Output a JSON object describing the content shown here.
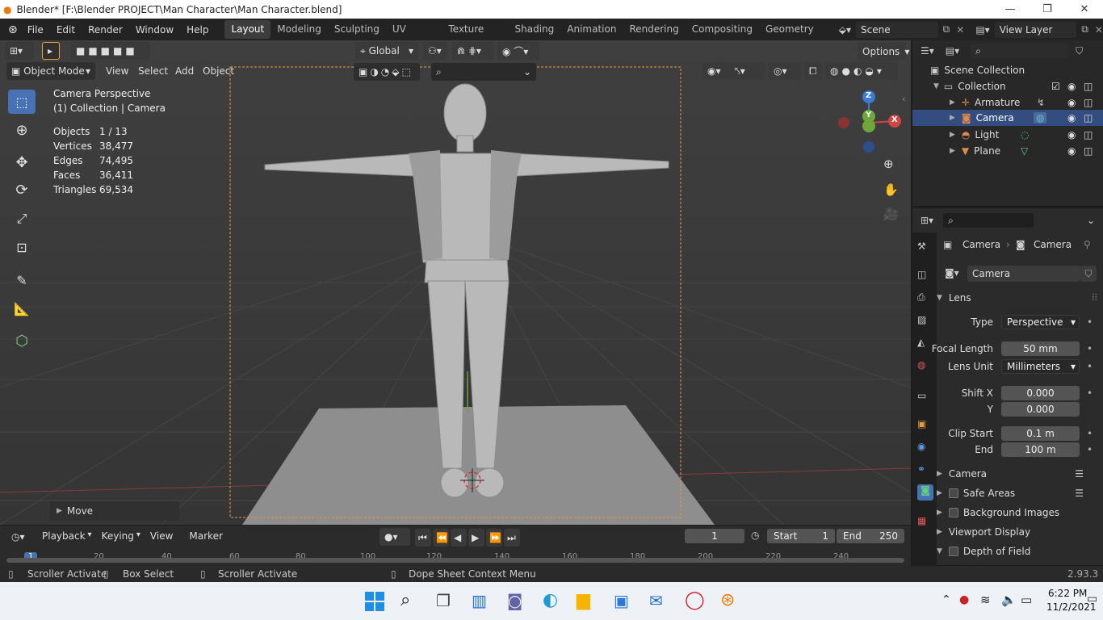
{
  "window": {
    "title": "Blender* [F:\\Blender PROJECT\\Man Character\\Man Character.blend]"
  },
  "menus": [
    "File",
    "Edit",
    "Render",
    "Window",
    "Help"
  ],
  "workspace_tabs": [
    "Layout",
    "Modeling",
    "Sculpting",
    "UV Editing",
    "Texture Paint",
    "Shading",
    "Animation",
    "Rendering",
    "Compositing",
    "Geometry Nod"
  ],
  "active_tab": "Layout",
  "scene_field": "Scene",
  "view_layer_field": "View Layer",
  "viewport": {
    "mode": "Object Mode",
    "menus": [
      "View",
      "Select",
      "Add",
      "Object"
    ],
    "transform_orientation": "Global",
    "options_label": "Options",
    "overlay_title": "Camera Perspective",
    "overlay_subtitle": "(1) Collection | Camera",
    "stats": [
      {
        "label": "Objects",
        "value": "1 / 13"
      },
      {
        "label": "Vertices",
        "value": "38,477"
      },
      {
        "label": "Edges",
        "value": "74,495"
      },
      {
        "label": "Faces",
        "value": "36,411"
      },
      {
        "label": "Triangles",
        "value": "69,534"
      }
    ],
    "last_op": "Move",
    "gizmo": {
      "z": "Z",
      "y": "Y",
      "x": "X"
    }
  },
  "outliner": {
    "root": "Scene Collection",
    "collection": "Collection",
    "items": [
      {
        "name": "Armature",
        "color": "#e0894a"
      },
      {
        "name": "Camera",
        "color": "#e0894a"
      },
      {
        "name": "Light",
        "color": "#e0894a"
      },
      {
        "name": "Plane",
        "color": "#e0894a"
      }
    ],
    "selected": "Camera"
  },
  "properties": {
    "breadcrumb_object": "Camera",
    "breadcrumb_data": "Camera",
    "datablock_name": "Camera",
    "lens_section": "Lens",
    "fields": {
      "type_label": "Type",
      "type_value": "Perspective",
      "focal_label": "Focal Length",
      "focal_value": "50 mm",
      "unit_label": "Lens Unit",
      "unit_value": "Millimeters",
      "shiftx_label": "Shift X",
      "shiftx_value": "0.000",
      "shifty_label": "Y",
      "shifty_value": "0.000",
      "clipstart_label": "Clip Start",
      "clipstart_value": "0.1 m",
      "clipend_label": "End",
      "clipend_value": "100 m"
    },
    "sections": [
      "Camera",
      "Safe Areas",
      "Background Images",
      "Viewport Display",
      "Depth of Field"
    ]
  },
  "timeline": {
    "menus": [
      "Playback",
      "Keying",
      "View",
      "Marker"
    ],
    "current_frame": "1",
    "start_label": "Start",
    "start_value": "1",
    "end_label": "End",
    "end_value": "250",
    "ruler": [
      "1",
      "20",
      "40",
      "60",
      "80",
      "100",
      "120",
      "140",
      "160",
      "180",
      "200",
      "220",
      "240"
    ]
  },
  "statusbar": {
    "left": "Scroller Activate",
    "box": "Box Select",
    "mid": "Scroller Activate",
    "context": "Dope Sheet Context Menu",
    "version": "2.93.3"
  },
  "taskbar": {
    "time": "6:22 PM",
    "date": "11/2/2021"
  },
  "colors": {
    "accent": "#4772b3",
    "selection": "#334d80",
    "camera_frame": "#e89a3c"
  }
}
